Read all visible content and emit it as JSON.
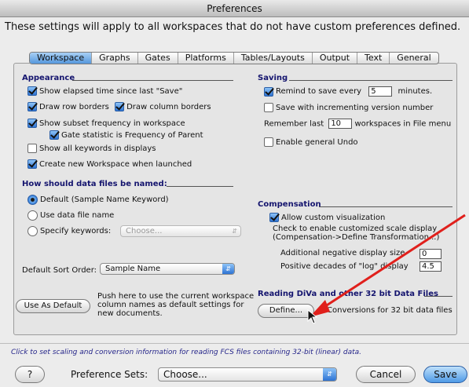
{
  "window": {
    "title": "Preferences"
  },
  "intro": "These settings will apply to all workspaces that do not have custom preferences defined.",
  "tabs": [
    {
      "label": "Workspace",
      "active": true
    },
    {
      "label": "Graphs"
    },
    {
      "label": "Gates"
    },
    {
      "label": "Platforms"
    },
    {
      "label": "Tables/Layouts"
    },
    {
      "label": "Output"
    },
    {
      "label": "Text"
    },
    {
      "label": "General"
    }
  ],
  "appearance": {
    "heading": "Appearance",
    "show_elapsed": "Show elapsed time since last \"Save\"",
    "draw_row_borders": "Draw row borders",
    "draw_column_borders": "Draw column borders",
    "show_subset_frequency": "Show subset frequency in workspace",
    "gate_statistic": "Gate statistic is Frequency of Parent",
    "show_all_keywords": "Show all keywords in displays",
    "create_new_workspace": "Create new Workspace when launched"
  },
  "naming": {
    "heading": "How should data files be named:",
    "option_default": "Default (Sample Name Keyword)",
    "option_filename": "Use data file name",
    "option_keywords": "Specify keywords:",
    "keywords_popup": "Choose..."
  },
  "sort_order": {
    "label": "Default Sort Order:",
    "value": "Sample Name"
  },
  "use_default": {
    "button": "Use As Default",
    "help_line1": "Push here to use the current workspace",
    "help_line2": "column names as default settings for",
    "help_line3": "new documents."
  },
  "saving": {
    "heading": "Saving",
    "remind_label": "Remind to save every",
    "remind_value": "5",
    "remind_unit": "minutes.",
    "incrementing": "Save with incrementing version number",
    "remember_prefix": "Remember last",
    "remember_value": "10",
    "remember_suffix": "workspaces in File menu",
    "general_undo": "Enable general Undo"
  },
  "compensation": {
    "heading": "Compensation",
    "custom_visualization": "Allow custom visualization",
    "help_line1": "Check to enable customized scale display",
    "help_line2": "(Compensation->Define Transformation...)",
    "neg_label": "Additional negative display size",
    "neg_value": "0",
    "decades_label": "Positive decades of \"log\" display",
    "decades_value": "4.5"
  },
  "diva": {
    "heading": "Reading DiVa and other 32 bit Data Files",
    "define_button": "Define...",
    "define_help": "Conversions for 32 bit data files"
  },
  "status_text": "Click to set scaling and conversion information for reading FCS files containing 32-bit (linear) data.",
  "footer": {
    "help_button": "?",
    "sets_label": "Preference Sets:",
    "sets_value": "Choose...",
    "cancel": "Cancel",
    "save": "Save"
  },
  "colors": {
    "accent": "#2d73d3",
    "heading": "#14146e",
    "status": "#26268a",
    "annotation_arrow": "#e0201c"
  }
}
